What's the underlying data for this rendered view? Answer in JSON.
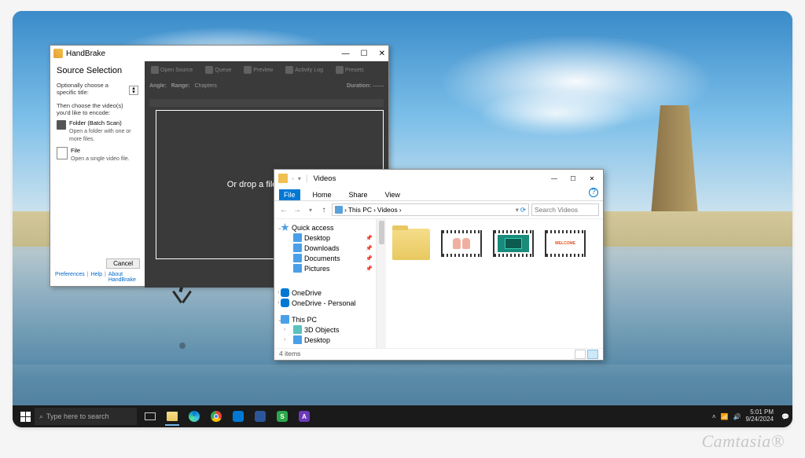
{
  "watermark": "Camtasia®",
  "handbrake": {
    "title": "HandBrake",
    "window_controls": {
      "min": "—",
      "max": "☐",
      "close": "✕"
    },
    "heading": "Source Selection",
    "optional_title_label": "Optionally choose a specific title:",
    "choose_label": "Then choose the video(s) you'd like to encode:",
    "options": [
      {
        "title": "Folder (Batch Scan)",
        "desc": "Open a folder with one or more files."
      },
      {
        "title": "File",
        "desc": "Open a single video file."
      }
    ],
    "dropzone_text": "Or drop a file, set of files...",
    "toolbar": [
      "Open Source",
      "Queue",
      "Preview",
      "Activity Log",
      "Presets"
    ],
    "subbar": {
      "angle": "Angle:",
      "range": "Range:",
      "chapters": "Chapters",
      "duration": "Duration:"
    },
    "cancel": "Cancel",
    "links": [
      "Preferences",
      "Help",
      "About HandBrake"
    ]
  },
  "explorer": {
    "title": "Videos",
    "tabs": {
      "file": "File",
      "home": "Home",
      "share": "Share",
      "view": "View"
    },
    "path": {
      "root": "This PC",
      "sep": "›",
      "current": "Videos",
      "refresh": "⟳"
    },
    "search_placeholder": "Search Videos",
    "nav": {
      "quick": "Quick access",
      "quick_items": [
        "Desktop",
        "Downloads",
        "Documents",
        "Pictures"
      ],
      "onedrive": "OneDrive",
      "onedrive_personal": "OneDrive - Personal",
      "thispc": "This PC",
      "thispc_items": [
        "3D Objects",
        "Desktop"
      ]
    },
    "status_count": "4 items",
    "window_controls": {
      "min": "—",
      "max": "☐",
      "close": "✕"
    }
  },
  "taskbar": {
    "search_placeholder": "Type here to search",
    "clock_time": "5:01 PM",
    "clock_date": "9/24/2024"
  }
}
